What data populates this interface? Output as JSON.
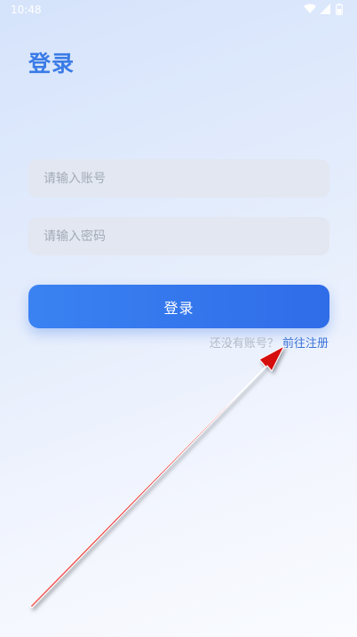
{
  "status_bar": {
    "time": "10:48",
    "icons": [
      "wifi-icon",
      "cellular-signal-icon",
      "battery-icon"
    ]
  },
  "login": {
    "title": "登录",
    "username_placeholder": "请输入账号",
    "password_placeholder": "请输入密码",
    "submit_label": "登录",
    "register_prompt": "还没有账号？",
    "register_link": "前往注册"
  },
  "colors": {
    "accent": "#3a7be6",
    "button_start": "#3a82f2",
    "button_end": "#2f6ce8",
    "annotation_arrow": "#e81818"
  }
}
